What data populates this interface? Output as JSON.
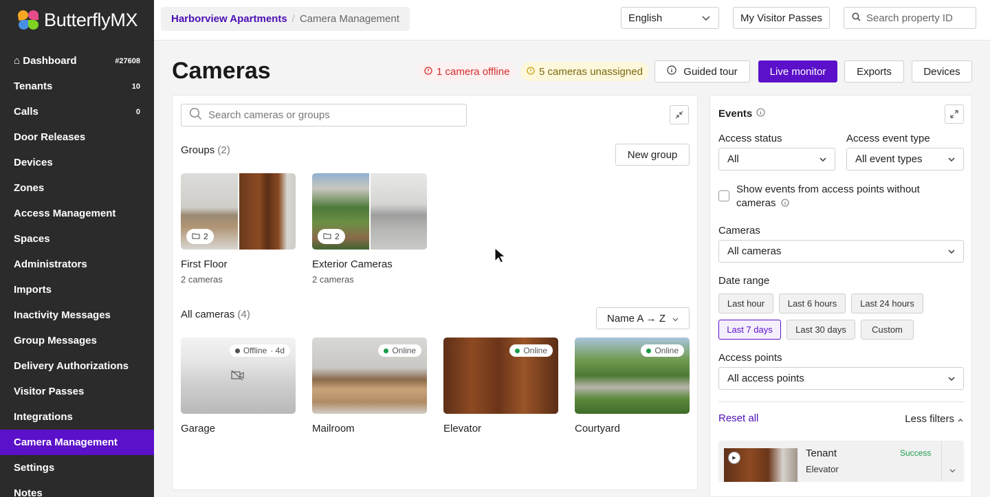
{
  "brand": {
    "name": "ButterflyMX"
  },
  "sidebar": {
    "items": [
      {
        "label": "Dashboard",
        "badge": "#27608",
        "icon": "home-icon"
      },
      {
        "label": "Tenants",
        "badge": "10"
      },
      {
        "label": "Calls",
        "badge": "0"
      },
      {
        "label": "Door Releases",
        "badge": ""
      },
      {
        "label": "Devices",
        "badge": ""
      },
      {
        "label": "Zones",
        "badge": ""
      },
      {
        "label": "Access Management",
        "badge": ""
      },
      {
        "label": "Spaces",
        "badge": ""
      },
      {
        "label": "Administrators",
        "badge": ""
      },
      {
        "label": "Imports",
        "badge": ""
      },
      {
        "label": "Inactivity Messages",
        "badge": ""
      },
      {
        "label": "Group Messages",
        "badge": ""
      },
      {
        "label": "Delivery Authorizations",
        "badge": ""
      },
      {
        "label": "Visitor Passes",
        "badge": ""
      },
      {
        "label": "Integrations",
        "badge": ""
      },
      {
        "label": "Camera Management",
        "badge": "",
        "active": true
      },
      {
        "label": "Settings",
        "badge": ""
      },
      {
        "label": "Notes",
        "badge": ""
      }
    ],
    "active_color": "#5b10c9"
  },
  "topbar": {
    "breadcrumb": {
      "property": "Harborview Apartments",
      "separator": "/",
      "current": "Camera Management"
    },
    "language": "English",
    "visitor_passes": "My Visitor Passes",
    "search_placeholder": "Search property ID"
  },
  "header": {
    "title": "Cameras",
    "offline_pill": "1 camera offline",
    "unassigned_pill": "5 cameras unassigned",
    "buttons": {
      "guided_tour": "Guided tour",
      "live_monitor": "Live monitor",
      "exports": "Exports",
      "devices": "Devices"
    }
  },
  "cameras_panel": {
    "search_placeholder": "Search cameras or groups",
    "groups_title": "Groups",
    "groups_count": "(2)",
    "new_group": "New group",
    "groups": [
      {
        "name": "First Floor",
        "sub": "2 cameras",
        "count": "2"
      },
      {
        "name": "Exterior Cameras",
        "sub": "2 cameras",
        "count": "2"
      }
    ],
    "all_title": "All cameras",
    "all_count": "(4)",
    "sort": "Name A → Z",
    "cameras": [
      {
        "name": "Garage",
        "status": "Offline",
        "extra": "· 4d",
        "status_color": "#d12c2c"
      },
      {
        "name": "Mailroom",
        "status": "Online",
        "extra": "",
        "status_color": "#1a9b4a"
      },
      {
        "name": "Elevator",
        "status": "Online",
        "extra": "",
        "status_color": "#1a9b4a"
      },
      {
        "name": "Courtyard",
        "status": "Online",
        "extra": "",
        "status_color": "#1a9b4a"
      }
    ]
  },
  "events_panel": {
    "title": "Events",
    "access_status_label": "Access status",
    "access_status_value": "All",
    "event_type_label": "Access event type",
    "event_type_value": "All event types",
    "show_events_label": "Show events from access points without cameras",
    "cameras_label": "Cameras",
    "cameras_value": "All cameras",
    "date_range_label": "Date range",
    "date_ranges": [
      "Last hour",
      "Last 6 hours",
      "Last 24 hours",
      "Last 7 days",
      "Last 30 days",
      "Custom"
    ],
    "date_range_selected": "Last 7 days",
    "access_points_label": "Access points",
    "access_points_value": "All access points",
    "reset": "Reset all",
    "less_filters": "Less filters",
    "event": {
      "who": "Tenant",
      "where": "Elevator",
      "status": "Success"
    }
  }
}
